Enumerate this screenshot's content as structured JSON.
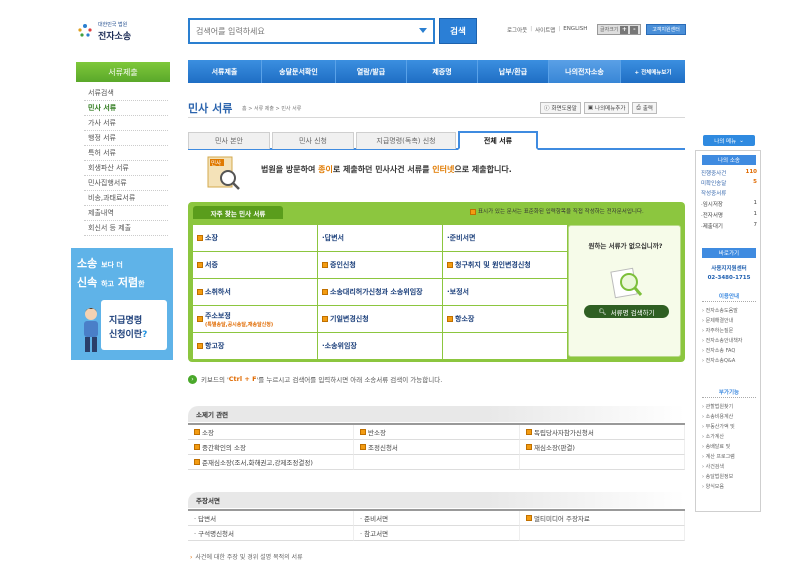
{
  "header": {
    "logo_top": "대한민국 법원",
    "logo_main": "전자소송",
    "search_placeholder": "검색어를 입력하세요",
    "search_button": "검색",
    "links": [
      "로그아웃",
      "사이트맵",
      "ENGLISH"
    ],
    "font_size_label": "글자크기",
    "helpdesk_button": "고객지원센터"
  },
  "nav": {
    "items": [
      "서류제출",
      "송달문서확인",
      "열람/발급",
      "제증명",
      "납부/환급",
      "나의전자소송",
      "+ 전체메뉴보기"
    ],
    "active_index": 5
  },
  "left_menu": {
    "title": "서류제출",
    "items": [
      "서류검색",
      "민사 서류",
      "가사 서류",
      "행정 서류",
      "특허 서류",
      "회생파산 서류",
      "민사집행서류",
      "비송,과태료서류",
      "제출내역",
      "회신서 등 제출"
    ],
    "active_index": 1
  },
  "banner": {
    "line1a": "소송",
    "line1b": "보다 더",
    "line2a": "신속",
    "line2b": "하고",
    "line2c": "저렴",
    "line2d": "한",
    "card1": "지급명령",
    "card2a": "신청이란",
    "card2b": "?"
  },
  "page": {
    "title": "민사 서류",
    "breadcrumb": "홈 > 서류 제출 > 민사 서류",
    "buttons": [
      "화면도움말",
      "나의메뉴추가",
      "출력"
    ]
  },
  "tabs": {
    "items": [
      "민사 본안",
      "민사 신청",
      "지급명령(독촉) 신청",
      "전체 서류"
    ],
    "active_index": 3
  },
  "info": {
    "icon_label": "민사",
    "text_a": "법원을 방문하여 ",
    "text_b": "종이",
    "text_c": "로 제출하던 민사사건 서류를 ",
    "text_d": "인터넷",
    "text_e": "으로 제출합니다."
  },
  "frequent": {
    "title": "자주 찾는 민사 서류",
    "note": "표시가 있는 문서는 표준화된 입력항목을 직접 작성하는 전자문서입니다.",
    "items": [
      {
        "label": "소장",
        "checked": true,
        "sub": ""
      },
      {
        "label": "·답변서",
        "checked": false,
        "sub": ""
      },
      {
        "label": "·준비서면",
        "checked": false,
        "sub": ""
      },
      {
        "label": "서증",
        "checked": true,
        "sub": ""
      },
      {
        "label": "증인신청",
        "checked": true,
        "sub": ""
      },
      {
        "label": "청구취지 및 원인변경신청",
        "checked": true,
        "sub": ""
      },
      {
        "label": "소취하서",
        "checked": true,
        "sub": ""
      },
      {
        "label": "소송대리허가신청과 소송위임장",
        "checked": true,
        "sub": ""
      },
      {
        "label": "·보정서",
        "checked": false,
        "sub": ""
      },
      {
        "label": "주소보정",
        "checked": true,
        "sub": "(특별송달,공시송달,재송달신청)"
      },
      {
        "label": "기일변경신청",
        "checked": true,
        "sub": ""
      },
      {
        "label": "항소장",
        "checked": true,
        "sub": ""
      },
      {
        "label": "항고장",
        "checked": true,
        "sub": ""
      },
      {
        "label": "·소송위임장",
        "checked": false,
        "sub": ""
      }
    ],
    "side_question": "원하는 서류가 없으십니까?",
    "side_button": "서류명 검색하기"
  },
  "hint": {
    "a": "키보드의 '",
    "key": "Ctrl + F",
    "b": "'를 누르시고 검색어를 입력하시면 아래 소송서류 검색이 가능합니다."
  },
  "section1": {
    "title": "소제기 관련",
    "items": [
      {
        "label": "소장",
        "checked": true
      },
      {
        "label": "반소장",
        "checked": true
      },
      {
        "label": "독립당사자참가신청서",
        "checked": true
      },
      {
        "label": "중간확인의 소장",
        "checked": true
      },
      {
        "label": "조정신청서",
        "checked": true
      },
      {
        "label": "재심소장(판결)",
        "checked": true
      },
      {
        "label": "준재심소장(조서,화해권고,강제조정결정)",
        "checked": true
      },
      {
        "label": "",
        "checked": false
      },
      {
        "label": "",
        "checked": false
      }
    ]
  },
  "section2": {
    "title": "주장서면",
    "items": [
      {
        "label": "· 답변서",
        "checked": false
      },
      {
        "label": "· 준비서면",
        "checked": false
      },
      {
        "label": "멀티미디어 주장자료",
        "checked": true
      },
      {
        "label": "· 구석명신청서",
        "checked": false
      },
      {
        "label": "· 참고서면",
        "checked": false
      },
      {
        "label": "",
        "checked": false
      }
    ],
    "note": "사건에 대한 주장 및 경위 설명 목적의 서류"
  },
  "right_panel": {
    "menu_button": "나의 메뉴",
    "section_title": "나의 소송",
    "rows": [
      {
        "label": "진행중사건",
        "value": "110"
      },
      {
        "label": "미확인송달",
        "value": "5"
      },
      {
        "label": "작성중서류",
        "value": ""
      }
    ],
    "subrows": [
      {
        "label": "·임시저장",
        "value": "1"
      },
      {
        "label": "·전자서명",
        "value": "1"
      },
      {
        "label": "·제출대기",
        "value": "7"
      }
    ],
    "shortcut_title": "바로가기",
    "contact_title": "사용지지원센터",
    "contact_phone": "02-3480-1715",
    "guide_title": "이용안내",
    "guide_links": [
      "전자소송도움말",
      "문제해결안내",
      "자주하는질문",
      "전자소송안내책자",
      "전자소송 FAQ",
      "전자소송Q&A"
    ],
    "tools_title": "부가기능",
    "tools_links": [
      "관할법원찾기",
      "소송비용계산",
      "부동산가액 및",
      "소가계산",
      "송배달료 및",
      "계산 프로그램",
      "사건검색",
      "송달법원정보",
      "양식모음"
    ]
  }
}
